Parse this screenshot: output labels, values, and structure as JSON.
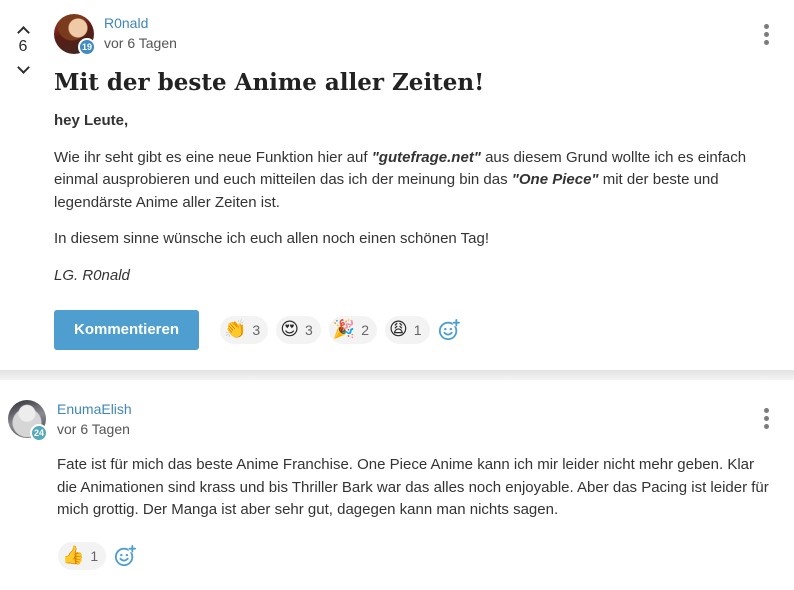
{
  "question": {
    "votes": "6",
    "author": {
      "name": "R0nald",
      "level_badge": "19",
      "time": "vor 6 Tagen"
    },
    "title": "Mit der beste Anime aller Zeiten!",
    "greeting": "hey Leute,",
    "paragraph1": {
      "part1": "Wie ihr seht gibt es eine neue Funktion hier auf ",
      "emph1": "\"gutefrage.net\"",
      "part2": " aus diesem Grund wollte ich es einfach einmal ausprobieren und euch mitteilen das ich der meinung bin das ",
      "emph2": "\"One Piece\"",
      "part3": " mit der beste und legendärste Anime aller Zeiten ist."
    },
    "paragraph2": "In diesem sinne wünsche ich euch allen noch einen schönen Tag!",
    "signature": "LG. R0nald",
    "comment_button_label": "Kommentieren",
    "reactions": [
      {
        "emoji": "👏",
        "count": "3",
        "icon": "clapping-hands-icon"
      },
      {
        "emoji": "😍",
        "count": "3",
        "icon": "heart-eyes-icon"
      },
      {
        "emoji": "🎉",
        "count": "2",
        "icon": "party-popper-icon"
      },
      {
        "emoji": "😩",
        "count": "1",
        "icon": "weary-face-icon"
      }
    ]
  },
  "answer": {
    "author": {
      "name": "EnumaElish",
      "level_badge": "24",
      "time": "vor 6 Tagen"
    },
    "text": "Fate ist für mich das beste Anime Franchise. One Piece Anime kann ich mir leider nicht mehr geben. Klar die Animationen sind krass und bis Thriller Bark war das alles noch enjoyable. Aber das Pacing ist leider für mich grottig. Der Manga ist aber sehr gut, dagegen kann man nichts sagen.",
    "reactions": [
      {
        "emoji": "👍",
        "count": "1",
        "icon": "thumbs-up-icon"
      }
    ]
  },
  "colors": {
    "accent": "#4e9fd0",
    "username": "#3f87b8",
    "badge_blue": "#3f8cc4",
    "badge_teal": "#56a9ba"
  }
}
